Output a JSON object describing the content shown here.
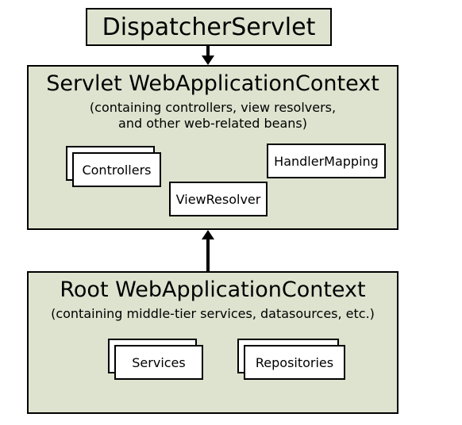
{
  "dispatcher": {
    "title": "DispatcherServlet"
  },
  "servletContext": {
    "title": "Servlet WebApplicationContext",
    "subtitle1": "(containing controllers, view resolvers,",
    "subtitle2": "and other web-related beans)",
    "controllers": "Controllers",
    "viewResolver": "ViewResolver",
    "handlerMapping": "HandlerMapping"
  },
  "rootContext": {
    "title": "Root WebApplicationContext",
    "subtitle": "(containing middle-tier services, datasources, etc.)",
    "services": "Services",
    "repositories": "Repositories"
  }
}
